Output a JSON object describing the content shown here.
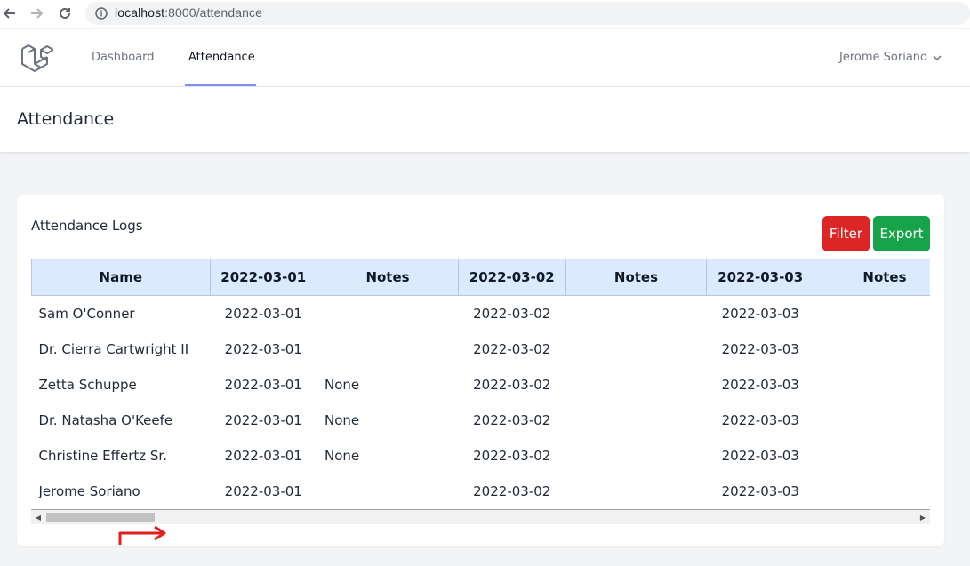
{
  "browser": {
    "url_host": "localhost",
    "url_path": ":8000/attendance"
  },
  "nav": {
    "links": [
      "Dashboard",
      "Attendance"
    ],
    "user": "Jerome Soriano"
  },
  "page": {
    "title": "Attendance"
  },
  "card": {
    "title": "Attendance Logs",
    "filter_label": "Filter",
    "export_label": "Export"
  },
  "table": {
    "headers": [
      "Name",
      "2022-03-01",
      "Notes",
      "2022-03-02",
      "Notes",
      "2022-03-03",
      "Notes"
    ],
    "rows": [
      [
        "Sam O'Conner",
        "2022-03-01",
        "",
        "2022-03-02",
        "",
        "2022-03-03",
        ""
      ],
      [
        "Dr. Cierra Cartwright II",
        "2022-03-01",
        "",
        "2022-03-02",
        "",
        "2022-03-03",
        ""
      ],
      [
        "Zetta Schuppe",
        "2022-03-01",
        "None",
        "2022-03-02",
        "",
        "2022-03-03",
        ""
      ],
      [
        "Dr. Natasha O'Keefe",
        "2022-03-01",
        "None",
        "2022-03-02",
        "",
        "2022-03-03",
        ""
      ],
      [
        "Christine Effertz Sr.",
        "2022-03-01",
        "None",
        "2022-03-02",
        "",
        "2022-03-03",
        ""
      ],
      [
        "Jerome Soriano",
        "2022-03-01",
        "",
        "2022-03-02",
        "",
        "2022-03-03",
        ""
      ]
    ]
  },
  "icons": {
    "back": "back-arrow-icon",
    "forward": "forward-arrow-icon",
    "reload": "reload-icon",
    "info": "info-icon",
    "logo": "laravel-logo-icon",
    "user_menu": "chevron-down-icon",
    "annotation": "red-arrow-annotation-icon"
  },
  "colors": {
    "filter": "#dc2626",
    "export": "#16a34a",
    "header_bg": "#dbeafe",
    "nav_active": "#818cf8"
  }
}
